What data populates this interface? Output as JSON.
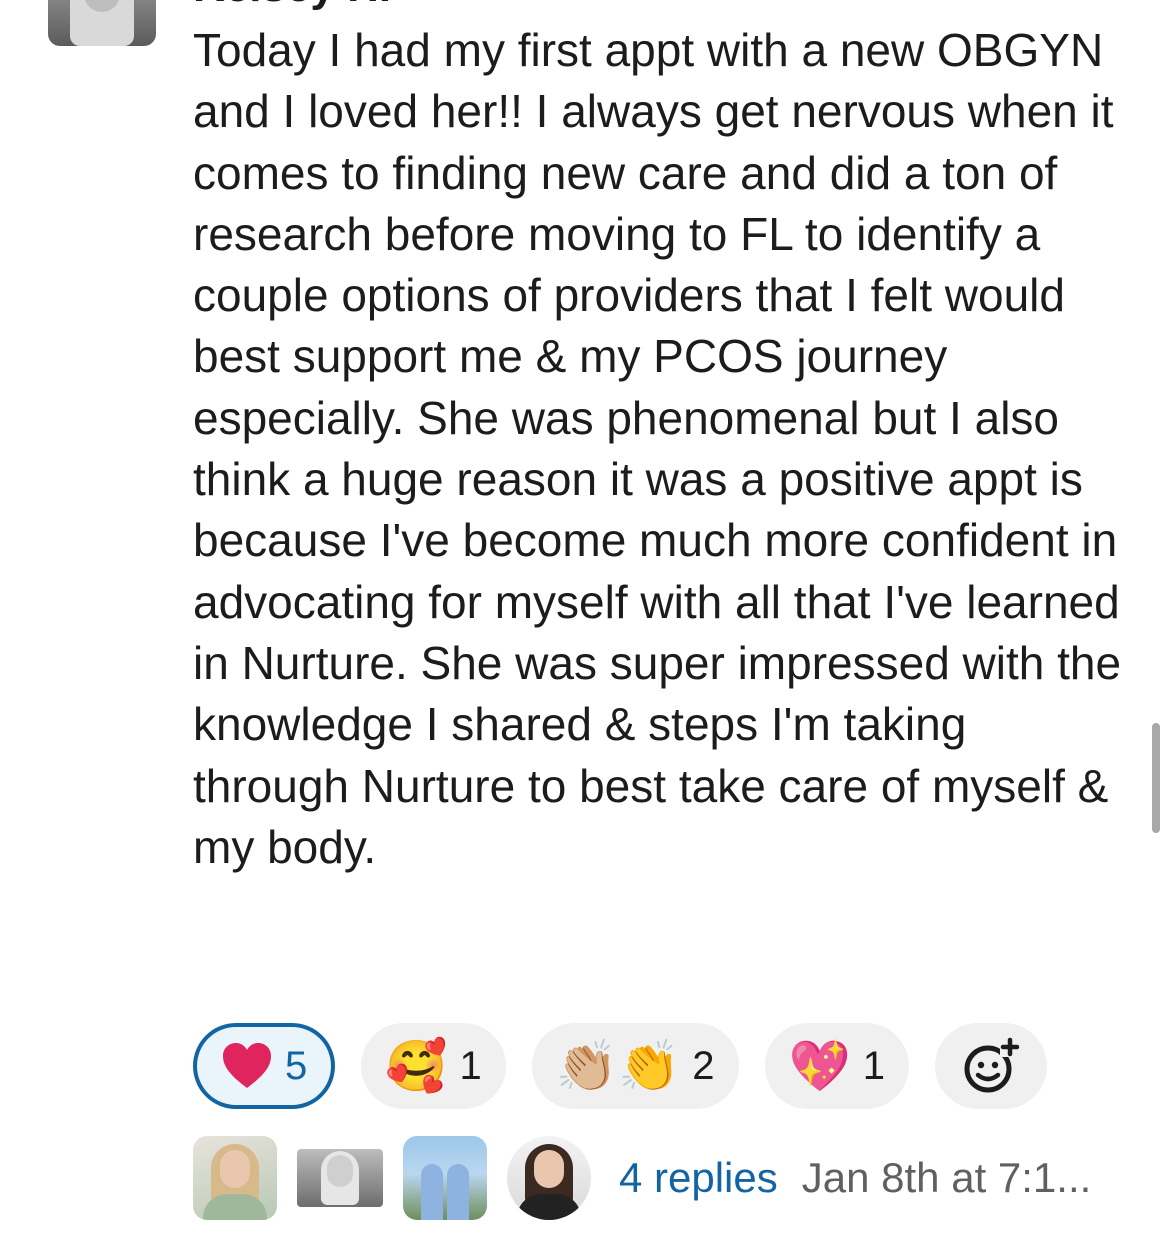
{
  "message": {
    "author": "Kelsey H.",
    "text": "Today I had my first appt with a new OBGYN and I loved her!! I always get nervous when it comes to finding new care and did a ton of research before moving to FL to identify a couple options of providers that I felt would best support me & my PCOS journey especially. She was phenomenal but I also think a huge reason it was a positive appt is because I've become much more confident in advocating for myself with all that I've learned in Nurture. She was super impressed with the knowledge I shared & steps I'm taking through Nurture to best take care of myself & my body."
  },
  "reactions": [
    {
      "emoji": "❤",
      "icon": "red-heart-icon",
      "count": "5",
      "selected": true
    },
    {
      "emoji": "🥰",
      "icon": "smiling-face-with-hearts-icon",
      "count": "1",
      "selected": false
    },
    {
      "emoji": "👏🏼👏",
      "icon": "clapping-hands-icon",
      "count": "2",
      "selected": false
    },
    {
      "emoji": "💖",
      "icon": "sparkling-heart-icon",
      "count": "1",
      "selected": false
    }
  ],
  "add_reaction_icon": "add-emoji-icon",
  "thread": {
    "replies_label": "4 replies",
    "timestamp": "Jan 8th at 7:1..."
  },
  "colors": {
    "link": "#1264a3",
    "selected_reaction_bg": "#e9f5fb",
    "reaction_bg": "#f0f0f0",
    "timestamp": "#616061",
    "heart": "#e0245e"
  }
}
